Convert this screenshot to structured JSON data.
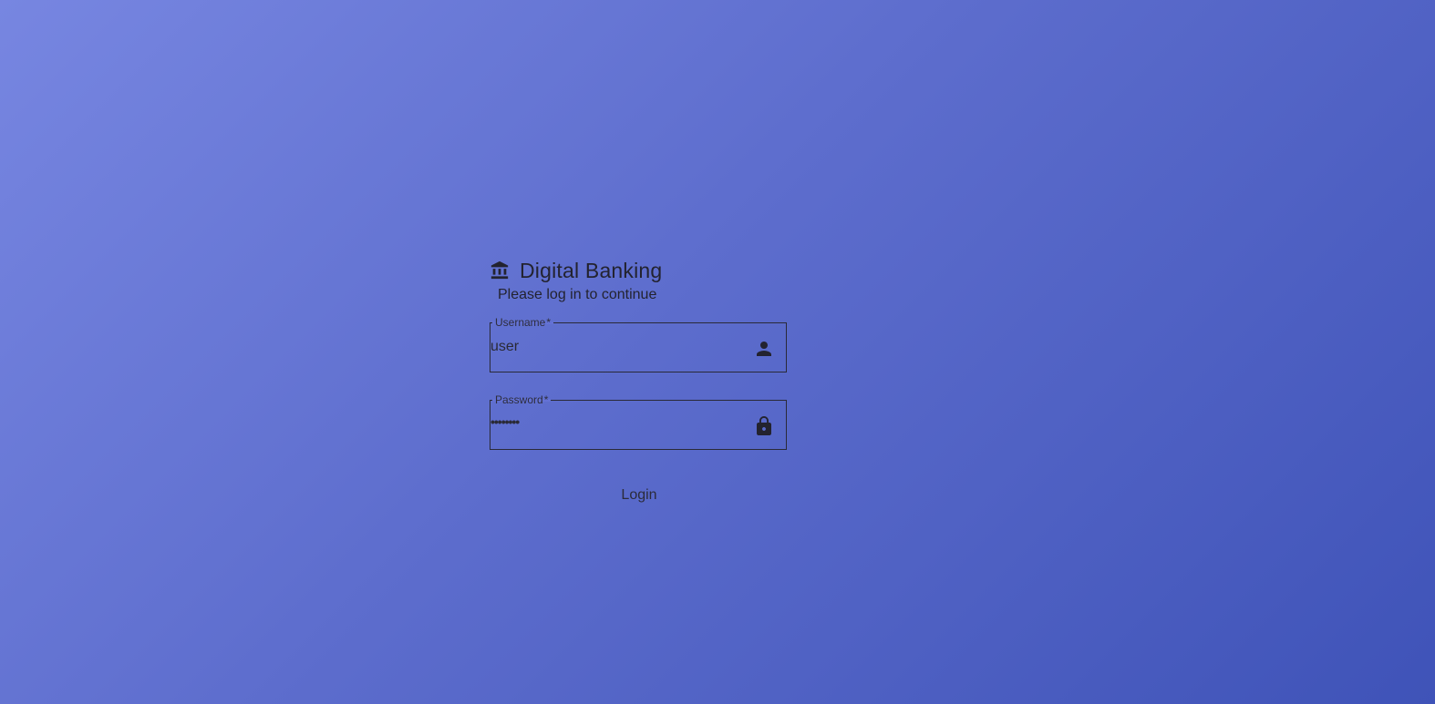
{
  "app": {
    "title": "Digital Banking",
    "subtitle": "Please log in to continue",
    "icon": "bank-icon"
  },
  "form": {
    "username": {
      "label": "Username",
      "required_mark": "*",
      "value": "user",
      "icon": "person-icon"
    },
    "password": {
      "label": "Password",
      "required_mark": "*",
      "value_masked": "••••••••",
      "icon": "lock-icon"
    },
    "submit_label": "Login"
  },
  "colors": {
    "gradient_start": "#7786e1",
    "gradient_end": "#3f53b8",
    "text": "#23232f"
  }
}
